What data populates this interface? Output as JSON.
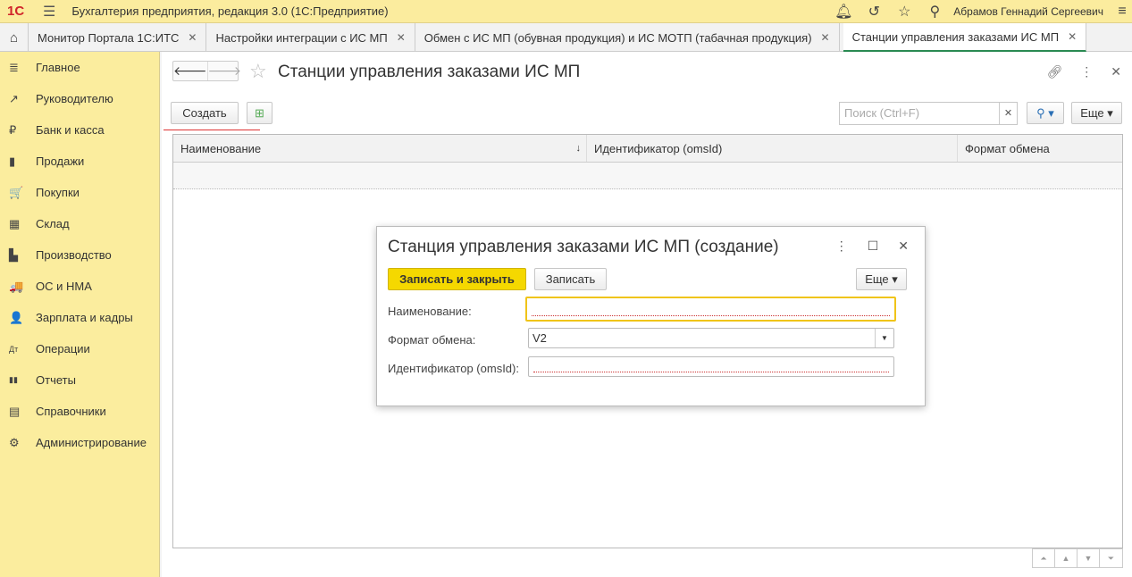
{
  "app": {
    "logo": "1С",
    "title": "Бухгалтерия предприятия, редакция 3.0  (1С:Предприятие)",
    "user": "Абрамов Геннадий Сергеевич"
  },
  "tabs": [
    {
      "label": "Монитор Портала 1С:ИТС"
    },
    {
      "label": "Настройки интеграции с ИС МП"
    },
    {
      "label": "Обмен с ИС МП (обувная продукция) и ИС МОТП (табачная продукция)"
    },
    {
      "label": "Станции управления заказами ИС МП",
      "active": true
    }
  ],
  "sidebar": [
    {
      "label": "Главное",
      "icon": "≣"
    },
    {
      "label": "Руководителю",
      "icon": "↗"
    },
    {
      "label": "Банк и касса",
      "icon": "₽"
    },
    {
      "label": "Продажи",
      "icon": "▮"
    },
    {
      "label": "Покупки",
      "icon": "🛒"
    },
    {
      "label": "Склад",
      "icon": "▦"
    },
    {
      "label": "Производство",
      "icon": "▙"
    },
    {
      "label": "ОС и НМА",
      "icon": "🚚"
    },
    {
      "label": "Зарплата и кадры",
      "icon": "👤"
    },
    {
      "label": "Операции",
      "icon": "Дт"
    },
    {
      "label": "Отчеты",
      "icon": "▮▮"
    },
    {
      "label": "Справочники",
      "icon": "▤"
    },
    {
      "label": "Администрирование",
      "icon": "⚙"
    }
  ],
  "page": {
    "title": "Станции управления заказами ИС МП",
    "create": "Создать",
    "search_placeholder": "Поиск (Ctrl+F)",
    "more": "Еще",
    "columns": [
      "Наименование",
      "Идентификатор (omsId)",
      "Формат обмена"
    ]
  },
  "dialog": {
    "title": "Станция управления заказами ИС МП (создание)",
    "save_close": "Записать и закрыть",
    "save": "Записать",
    "more": "Еще",
    "fields": {
      "name_label": "Наименование:",
      "name_value": "",
      "format_label": "Формат обмена:",
      "format_value": "V2",
      "id_label": "Идентификатор (omsId):",
      "id_value": ""
    }
  },
  "colors": {
    "top": "#fbec9e",
    "accent": "#2a8a52",
    "primary": "#f5d800"
  }
}
